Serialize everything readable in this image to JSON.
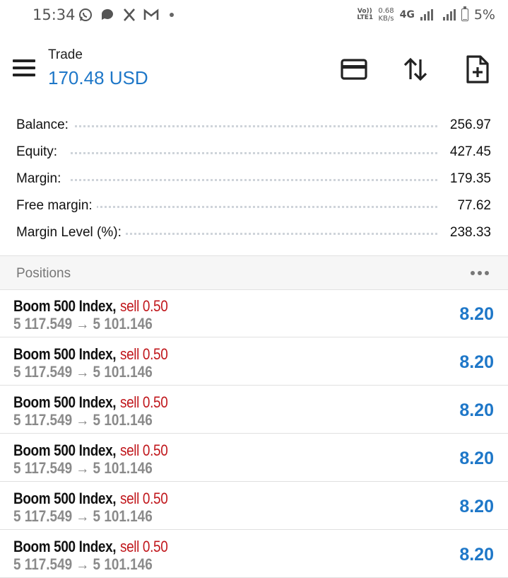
{
  "status_bar": {
    "time": "15:34",
    "left_icons": [
      "whatsapp-icon",
      "chat-icon",
      "x-icon",
      "gmail-icon"
    ],
    "volte": "Vo)) LTE1",
    "speed_value": "0.68",
    "speed_unit": "KB/s",
    "network": "4G",
    "battery_percent": "5%",
    "battery_level": 0.05
  },
  "header": {
    "title": "Trade",
    "subtitle": "170.48 USD",
    "actions": [
      "card-icon",
      "sort-arrows-icon",
      "add-document-icon"
    ]
  },
  "account": [
    {
      "label": "Balance:",
      "value": "256.97"
    },
    {
      "label": "Equity:",
      "value": "427.45"
    },
    {
      "label": "Margin:",
      "value": "179.35"
    },
    {
      "label": "Free margin:",
      "value": "77.62"
    },
    {
      "label": "Margin Level (%):",
      "value": "238.33"
    }
  ],
  "positions": {
    "title": "Positions",
    "items": [
      {
        "symbol": "Boom 500 Index,",
        "side": "sell 0.50",
        "prices": "5 117.549 → 5 101.146",
        "profit": "8.20"
      },
      {
        "symbol": "Boom 500 Index,",
        "side": "sell 0.50",
        "prices": "5 117.549 → 5 101.146",
        "profit": "8.20"
      },
      {
        "symbol": "Boom 500 Index,",
        "side": "sell 0.50",
        "prices": "5 117.549 → 5 101.146",
        "profit": "8.20"
      },
      {
        "symbol": "Boom 500 Index,",
        "side": "sell 0.50",
        "prices": "5 117.549 → 5 101.146",
        "profit": "8.20"
      },
      {
        "symbol": "Boom 500 Index,",
        "side": "sell 0.50",
        "prices": "5 117.549 → 5 101.146",
        "profit": "8.20"
      },
      {
        "symbol": "Boom 500 Index,",
        "side": "sell 0.50",
        "prices": "5 117.549 → 5 101.146",
        "profit": "8.20"
      }
    ]
  },
  "colors": {
    "accent": "#1e77c8",
    "sell": "#c0161b",
    "muted": "#8a8a8a"
  }
}
